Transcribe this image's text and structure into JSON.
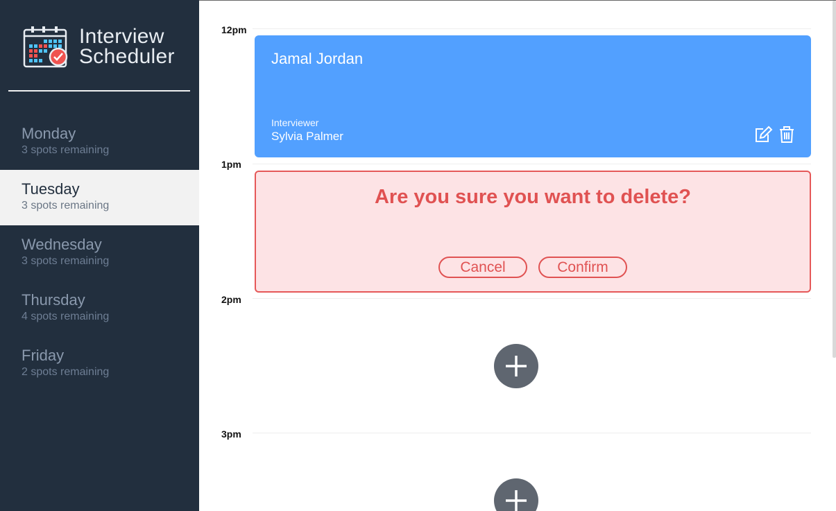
{
  "app": {
    "title_line1": "Interview",
    "title_line2": "Scheduler",
    "logo": "calendar-check-icon"
  },
  "days": [
    {
      "name": "Monday",
      "spots": "3 spots remaining",
      "selected": false
    },
    {
      "name": "Tuesday",
      "spots": "3 spots remaining",
      "selected": true
    },
    {
      "name": "Wednesday",
      "spots": "3 spots remaining",
      "selected": false
    },
    {
      "name": "Thursday",
      "spots": "4 spots remaining",
      "selected": false
    },
    {
      "name": "Friday",
      "spots": "2 spots remaining",
      "selected": false
    }
  ],
  "times": [
    "12pm",
    "1pm",
    "2pm",
    "3pm"
  ],
  "appointment": {
    "student": "Jamal Jordan",
    "interviewer_label": "Interviewer",
    "interviewer": "Sylvia Palmer",
    "edit_icon": "edit-icon",
    "delete_icon": "trash-icon"
  },
  "confirm": {
    "message": "Are you sure you want to delete?",
    "cancel_label": "Cancel",
    "confirm_label": "Confirm"
  },
  "add_icon": "plus-icon",
  "colors": {
    "sidebar": "#222f3e",
    "appointment": "#52a0ff",
    "danger": "#e05252",
    "danger_bg": "#fde3e5",
    "add_button": "#5f6670"
  }
}
